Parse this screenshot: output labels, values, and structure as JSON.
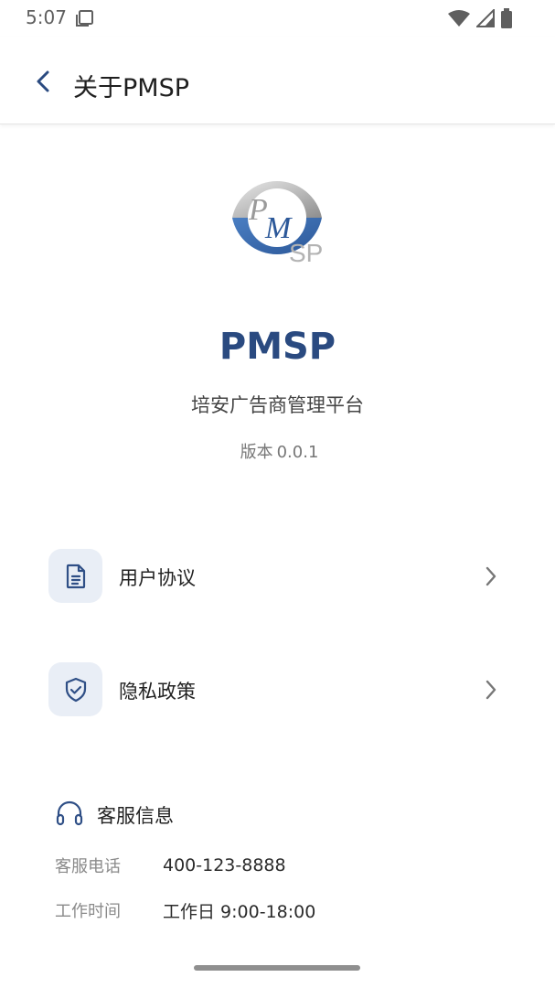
{
  "status_bar": {
    "time": "5:07",
    "icons": [
      "notification-icon",
      "wifi-icon",
      "signal-icon",
      "battery-icon"
    ]
  },
  "app_bar": {
    "title": "关于PMSP",
    "back_icon": "chevron-left-icon"
  },
  "about": {
    "logo_letters": "PMSP",
    "app_name": "PMSP",
    "subtitle": "培安广告商管理平台",
    "version_label": "版本",
    "version_number": "0.0.1"
  },
  "menu": {
    "items": [
      {
        "label": "用户协议",
        "icon": "document-icon"
      },
      {
        "label": "隐私政策",
        "icon": "shield-check-icon"
      }
    ]
  },
  "customer_service": {
    "title": "客服信息",
    "icon": "headphones-icon",
    "rows": [
      {
        "key": "客服电话",
        "value": "400-123-8888"
      },
      {
        "key": "工作时间",
        "value": "工作日 9:00-18:00"
      }
    ]
  },
  "colors": {
    "brand_blue": "#2a4a80",
    "icon_bg": "#e9eef6"
  }
}
